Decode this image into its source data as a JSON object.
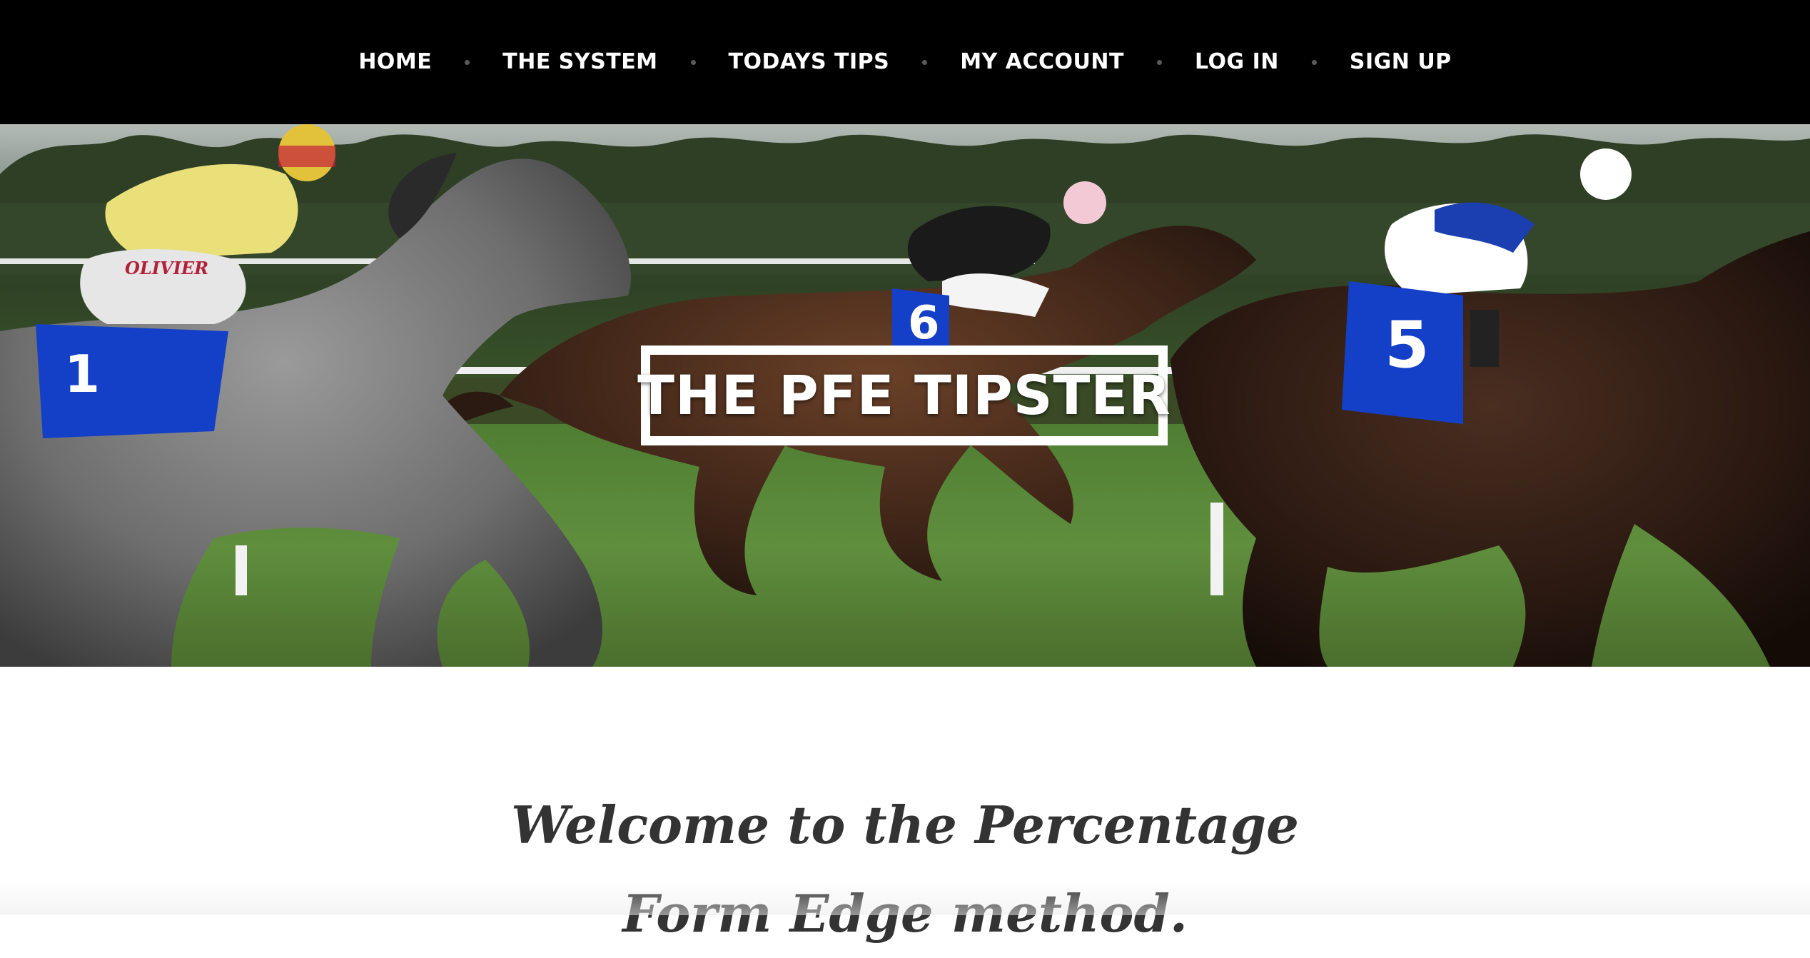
{
  "nav": {
    "items": [
      {
        "label": "HOME"
      },
      {
        "label": "THE SYSTEM"
      },
      {
        "label": "TODAYS TIPS"
      },
      {
        "label": "MY ACCOUNT"
      },
      {
        "label": "LOG IN"
      },
      {
        "label": "SIGN UP"
      }
    ]
  },
  "hero": {
    "site_title": "THE PFE TIPSTER",
    "image_text": {
      "jockey_name": "OLIVIER",
      "saddle_cloth_1_number": "1",
      "saddle_cloth_2_number": "6",
      "saddle_cloth_3_number": "5"
    }
  },
  "content": {
    "welcome_heading": "Welcome to the Percentage Form Edge method."
  },
  "colors": {
    "nav_background": "#000000",
    "nav_text": "#ffffff",
    "heading_text": "#333333"
  }
}
